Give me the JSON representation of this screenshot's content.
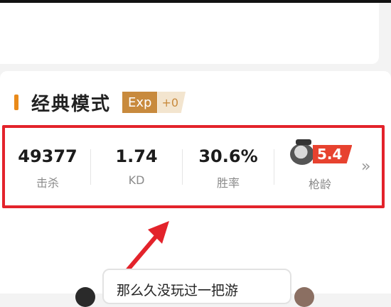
{
  "mode": {
    "title": "经典模式",
    "exp_label": "Exp",
    "exp_value": "+0"
  },
  "stats": [
    {
      "value": "49377",
      "label": "击杀"
    },
    {
      "value": "1.74",
      "label": "KD"
    },
    {
      "value": "30.6%",
      "label": "胜率"
    }
  ],
  "gun_age": {
    "value": "5.4",
    "label": "枪龄",
    "icon": "gun-age-icon"
  },
  "more_icon": "double-chevron-right-icon",
  "bubble": {
    "text": "那么久没玩过一把游"
  },
  "colors": {
    "accent_orange": "#e98a1a",
    "exp_badge": "#c88a3d",
    "highlight_red": "#e3232b",
    "gun_badge_red": "#e7422f"
  }
}
